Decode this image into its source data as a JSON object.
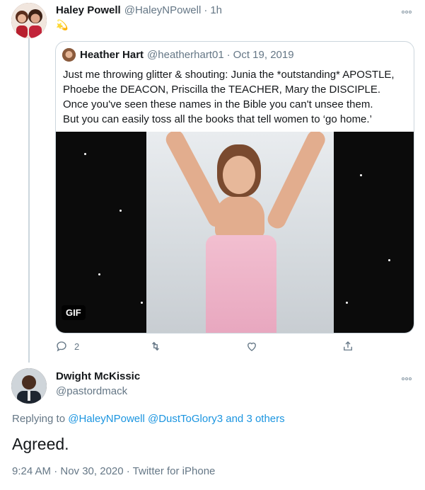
{
  "tweet": {
    "author_name": "Haley Powell",
    "author_handle": "@HaleyNPowell",
    "separator": "·",
    "time": "1h",
    "body_emoji": "💫"
  },
  "quoted_tweet": {
    "author_name": "Heather Hart",
    "author_handle": "@heatherhart01",
    "separator": "·",
    "date": "Oct 19, 2019",
    "text_lines": [
      "Just me throwing glitter & shouting: Junia the *outstanding* APOSTLE,",
      "Phoebe the DEACON, Priscilla the TEACHER, Mary the DISCIPLE.",
      "Once you've seen these names in the Bible you can't unsee them.",
      "But you can easily toss all the books that tell women to ‘go home.’"
    ],
    "media_badge": "GIF"
  },
  "actions": {
    "reply_count": "2",
    "icons": [
      "reply-icon",
      "retweet-icon",
      "like-icon",
      "share-icon"
    ]
  },
  "reply_tweet": {
    "author_name": "Dwight McKissic",
    "author_handle": "@pastordmack",
    "replying_to_label": "Replying to",
    "replying_to_users": "@HaleyNPowell @DustToGlory3",
    "replying_to_others": "and 3 others",
    "text": "Agreed.",
    "timestamp": "9:24 AM · Nov 30, 2020 · Twitter for iPhone"
  },
  "colors": {
    "link": "#1b95e0",
    "secondary_text": "#657786",
    "border": "#ccd6dd"
  }
}
